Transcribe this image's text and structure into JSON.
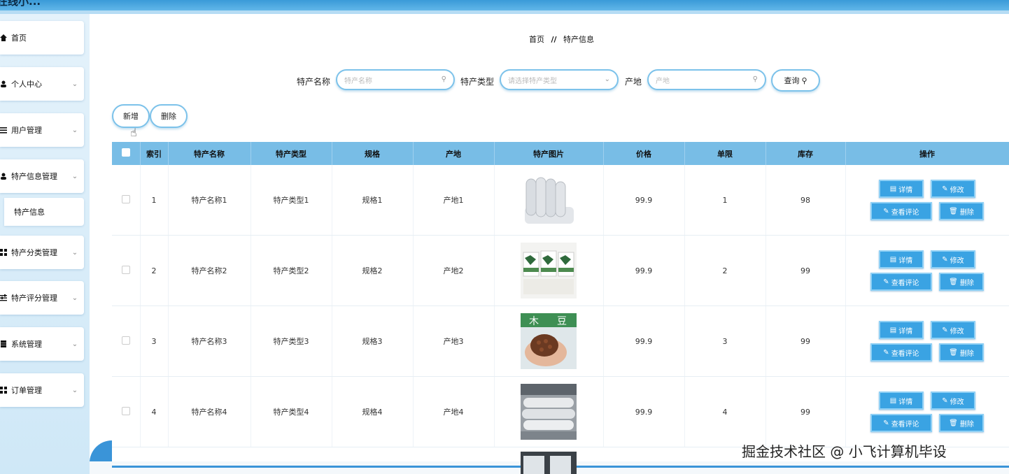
{
  "app": {
    "title": "在线小..."
  },
  "sidebar": {
    "items": [
      {
        "label": "首页",
        "icon": "home-icon",
        "chevron": false
      },
      {
        "label": "个人中心",
        "icon": "user-icon",
        "chevron": true
      },
      {
        "label": "用户管理",
        "icon": "list-icon",
        "chevron": true
      },
      {
        "label": "特产信息管理",
        "icon": "user-icon",
        "chevron": true
      },
      {
        "label": "特产分类管理",
        "icon": "grid-icon",
        "chevron": true
      },
      {
        "label": "特产评分管理",
        "icon": "sliders-icon",
        "chevron": true
      },
      {
        "label": "系统管理",
        "icon": "stack-icon",
        "chevron": true
      },
      {
        "label": "订单管理",
        "icon": "grid-icon",
        "chevron": true
      }
    ],
    "sub": {
      "label": "特产信息"
    }
  },
  "breadcrumb": {
    "home": "首页",
    "sep": "//",
    "current": "特产信息"
  },
  "search": {
    "name_label": "特产名称",
    "name_placeholder": "特产名称",
    "type_label": "特产类型",
    "type_placeholder": "请选择特产类型",
    "origin_label": "产地",
    "origin_placeholder": "产地",
    "query_label": "查询"
  },
  "toolbar": {
    "add_label": "新增",
    "delete_label": "删除"
  },
  "table": {
    "headers": [
      "索引",
      "特产名称",
      "特产类型",
      "规格",
      "产地",
      "特产图片",
      "价格",
      "单限",
      "库存",
      "操作"
    ],
    "rows": [
      {
        "index": "1",
        "name": "特产名称1",
        "type": "特产类型1",
        "spec": "规格1",
        "origin": "产地1",
        "image": "foam-rolls-image",
        "price": "99.9",
        "limit": "1",
        "stock": "98"
      },
      {
        "index": "2",
        "name": "特产名称2",
        "type": "特产类型2",
        "spec": "规格2",
        "origin": "产地2",
        "image": "fertilizer-bags-image",
        "price": "99.9",
        "limit": "2",
        "stock": "99"
      },
      {
        "index": "3",
        "name": "特产名称3",
        "type": "特产类型3",
        "spec": "规格3",
        "origin": "产地3",
        "image": "beans-in-hand-image",
        "price": "99.9",
        "limit": "3",
        "stock": "99"
      },
      {
        "index": "4",
        "name": "特产名称4",
        "type": "特产类型4",
        "spec": "规格4",
        "origin": "产地4",
        "image": "fabric-rolls-image",
        "price": "99.9",
        "limit": "4",
        "stock": "99"
      }
    ],
    "actions": {
      "detail": "详情",
      "edit": "修改",
      "comments": "查看评论",
      "delete": "删除"
    }
  },
  "watermark": "掘金技术社区 @ 小飞计算机毕设",
  "colors": {
    "accent": "#3aa3e3",
    "header_bg": "#78bde6",
    "border": "#7cc2ea"
  }
}
